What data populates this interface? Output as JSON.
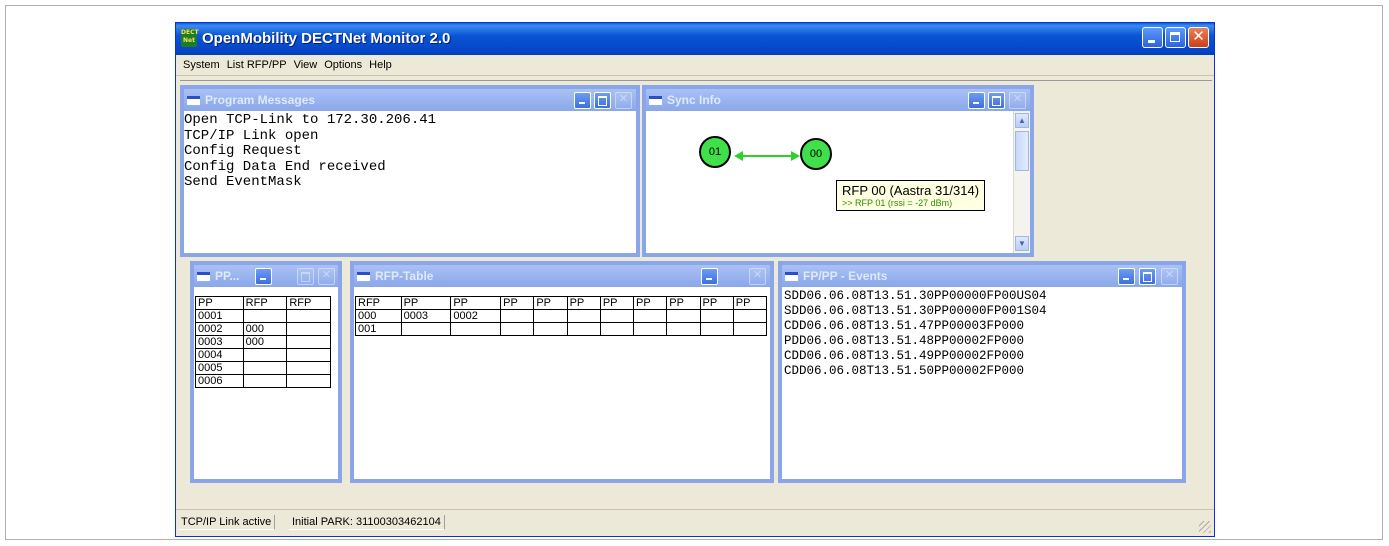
{
  "window": {
    "title": "OpenMobility DECTNet Monitor  2.0",
    "icon_text_top": "DECT",
    "icon_text_bottom": "Net"
  },
  "menu": [
    "System",
    "List RFP/PP",
    "View",
    "Options",
    "Help"
  ],
  "program_messages": {
    "title": "Program Messages",
    "lines": [
      "Open TCP-Link to 172.30.206.41",
      "TCP/IP Link open",
      "Config Request",
      "Config Data End received",
      "Send EventMask"
    ]
  },
  "sync_info": {
    "title": "Sync Info",
    "nodes": [
      "01",
      "00"
    ],
    "tooltip_main": "RFP 00 (Aastra 31/314)",
    "tooltip_sub": ">> RFP 01 (rssi = -27 dBm)"
  },
  "pp_table": {
    "title": "PP...",
    "headers": [
      "PP",
      "RFP",
      "RFP"
    ],
    "rows": [
      [
        "0001",
        "",
        ""
      ],
      [
        "0002",
        "000",
        ""
      ],
      [
        "0003",
        "000",
        ""
      ],
      [
        "0004",
        "",
        ""
      ],
      [
        "0005",
        "",
        ""
      ],
      [
        "0006",
        "",
        ""
      ]
    ]
  },
  "rfp_table": {
    "title": "RFP-Table",
    "headers": [
      "RFP",
      "PP",
      "PP",
      "PP",
      "PP",
      "PP",
      "PP",
      "PP",
      "PP",
      "PP",
      "PP"
    ],
    "rows": [
      [
        "000",
        "0003",
        "0002",
        "",
        "",
        "",
        "",
        "",
        "",
        "",
        ""
      ],
      [
        "001",
        "",
        "",
        "",
        "",
        "",
        "",
        "",
        "",
        "",
        ""
      ]
    ]
  },
  "fp_events": {
    "title": "FP/PP - Events",
    "lines": [
      "SDD06.06.08T13.51.30PP00000FP00US04",
      "SDD06.06.08T13.51.30PP00000FP001S04",
      "CDD06.06.08T13.51.47PP00003FP000",
      "PDD06.06.08T13.51.48PP00002FP000",
      "CDD06.06.08T13.51.49PP00002FP000",
      "CDD06.06.08T13.51.50PP00002FP000"
    ]
  },
  "status": {
    "link": "TCP/IP Link active",
    "park": "Initial PARK: 31100303462104"
  },
  "colors": {
    "node_fill": "#3fe04a",
    "arrow": "#2ed02e",
    "titlebar": "#0a54d4"
  }
}
